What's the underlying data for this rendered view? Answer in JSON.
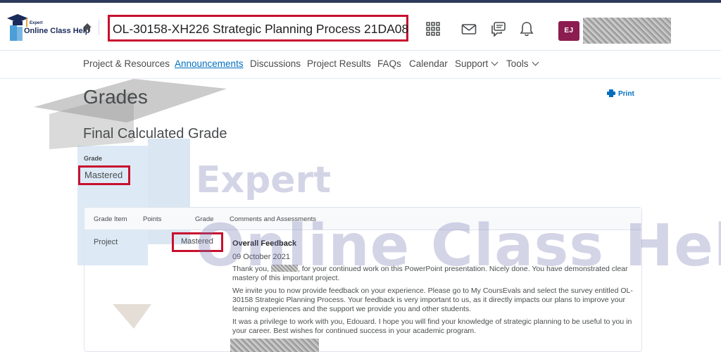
{
  "brand": {
    "logo_small": "Expert",
    "logo_big": "Online Class Help"
  },
  "header": {
    "course_title": "OL-30158-XH226 Strategic Planning Process 21DA08",
    "avatar_initials": "EJ",
    "icons": [
      "home-icon",
      "grid-icon",
      "mail-icon",
      "chat-icon",
      "bell-icon"
    ]
  },
  "nav": {
    "items": [
      {
        "label": "Project & Resources",
        "active": false
      },
      {
        "label": "Announcements",
        "active": true
      },
      {
        "label": "Discussions",
        "active": false
      },
      {
        "label": "Project Results",
        "active": false
      },
      {
        "label": "FAQs",
        "active": false
      },
      {
        "label": "Calendar",
        "active": false
      },
      {
        "label": "Support",
        "active": false,
        "dropdown": true
      },
      {
        "label": "Tools",
        "active": false,
        "dropdown": true
      }
    ]
  },
  "page": {
    "title": "Grades",
    "print_label": "Print",
    "section_title": "Final Calculated Grade",
    "grade_label": "Grade",
    "grade_value": "Mastered"
  },
  "table": {
    "headers": [
      "Grade Item",
      "Points",
      "Grade",
      "Comments and Assessments"
    ],
    "row": {
      "item": "Project",
      "grade": "Mastered",
      "feedback_title": "Overall Feedback",
      "feedback_date": "09 October 2021",
      "p1_a": "Thank you,",
      "p1_b": ", for your continued work on this PowerPoint presentation. Nicely done. You have demonstrated clear mastery of this important project.",
      "p2": "We invite you to now provide feedback on your experience. Please go to My CoursEvals and select the survey entitled OL-30158 Strategic Planning Process. Your feedback is very important to us, as it directly impacts our plans to improve your learning experiences and the support we provide you and other students.",
      "p3": "It was a privilege to work with you, Edouard. I hope you will find your knowledge of strategic planning to be useful to you in your career. Best wishes for continued success in your academic program."
    }
  },
  "watermark": {
    "line1": "Expert",
    "line2": "Online Class Help"
  },
  "colors": {
    "accent": "#006fbf",
    "highlight_box": "#c8102e",
    "avatar_bg": "#8c1d51",
    "text": "#494c4e"
  }
}
